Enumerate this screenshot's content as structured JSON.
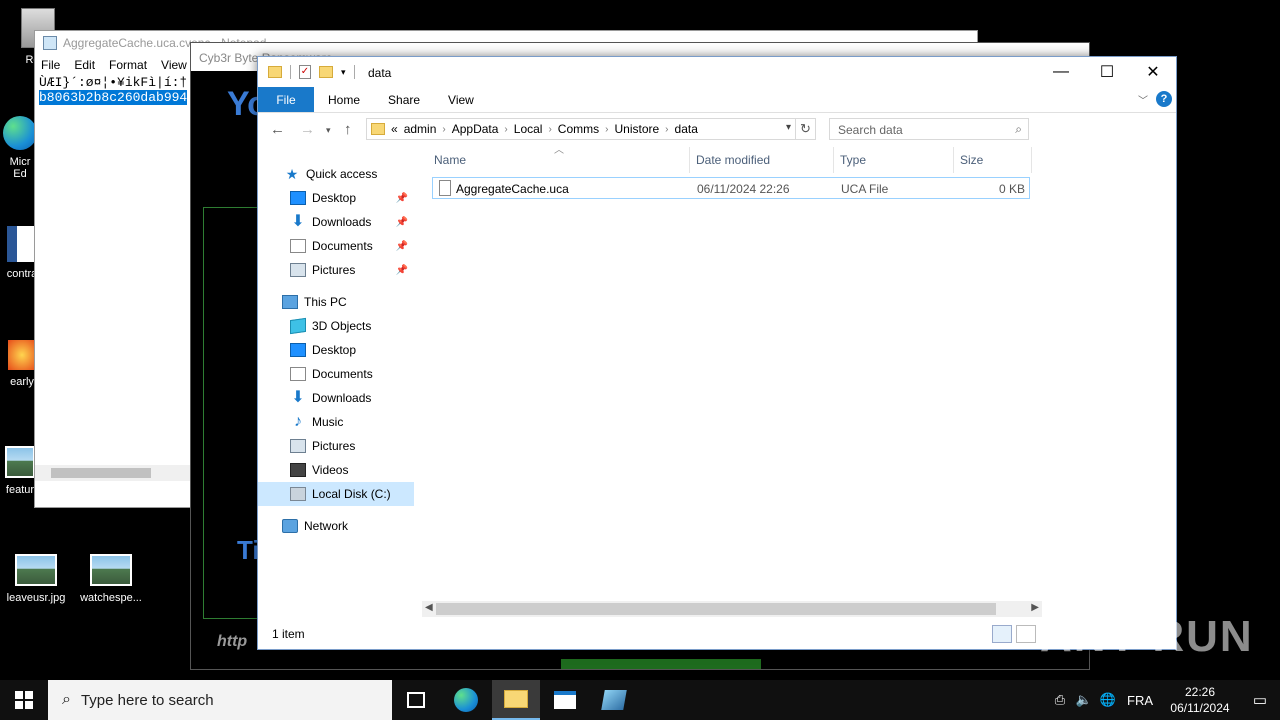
{
  "desktop": {
    "icons": [
      {
        "label": "Recy"
      },
      {
        "label": "Micr\nEd"
      },
      {
        "label": "contra"
      },
      {
        "label": "early"
      },
      {
        "label": "featur"
      },
      {
        "label": "leaveusr.jpg"
      },
      {
        "label": "watchespe..."
      }
    ]
  },
  "notepad": {
    "title": "AggregateCache.uca.cvenc - Notepad",
    "menu": [
      "File",
      "Edit",
      "Format",
      "View"
    ],
    "line1": "ÙÆI}´:ø¤¦•¥ikFì|í:†",
    "line2": "b8063b2b8c260dab994"
  },
  "ransom_window": {
    "title": "Cyb3r Byte Ransomware",
    "big_text": "Yo",
    "lower_text": "Ti",
    "link_text": "http"
  },
  "explorer": {
    "title": "data",
    "ribbon_tabs": [
      "File",
      "Home",
      "Share",
      "View"
    ],
    "address": {
      "prefix": "«",
      "crumbs": [
        "admin",
        "AppData",
        "Local",
        "Comms",
        "Unistore",
        "data"
      ]
    },
    "search_placeholder": "Search data",
    "nav": {
      "quick_access": "Quick access",
      "quick_items": [
        "Desktop",
        "Downloads",
        "Documents",
        "Pictures"
      ],
      "this_pc": "This PC",
      "pc_items": [
        "3D Objects",
        "Desktop",
        "Documents",
        "Downloads",
        "Music",
        "Pictures",
        "Videos",
        "Local Disk (C:)"
      ],
      "network": "Network"
    },
    "columns": {
      "name": "Name",
      "date": "Date modified",
      "type": "Type",
      "size": "Size"
    },
    "files": [
      {
        "name": "AggregateCache.uca",
        "date": "06/11/2024 22:26",
        "type": "UCA File",
        "size": "0 KB"
      }
    ],
    "status": "1 item"
  },
  "watermark": "ANY RUN",
  "taskbar": {
    "search_placeholder": "Type here to search",
    "language": "FRA",
    "time": "22:26",
    "date": "06/11/2024"
  }
}
